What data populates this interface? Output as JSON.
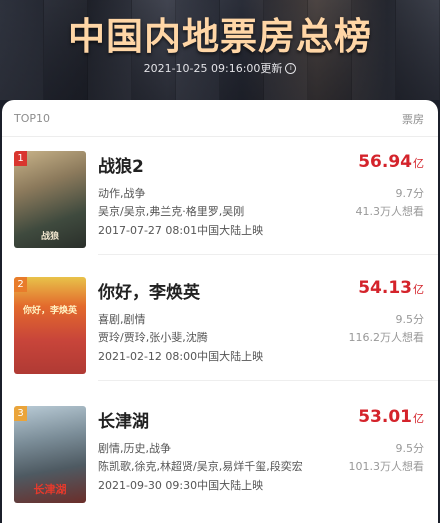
{
  "header": {
    "title": "中国内地票房总榜",
    "updated": "2021-10-25 09:16:00更新",
    "info_icon": "info-icon"
  },
  "list": {
    "label_left": "TOP10",
    "label_right": "票房",
    "items": [
      {
        "rank": "1",
        "title": "战狼2",
        "gross": "56.94",
        "gross_unit": "亿",
        "genre": "动作,战争",
        "cast": "吴京/吴京,弗兰克·格里罗,吴刚",
        "release": "2017-07-27 08:01中国大陆上映",
        "score": "9.7分",
        "wants": "41.3万人想看",
        "poster_caption": "战狼",
        "rank_color": "#d9362f"
      },
      {
        "rank": "2",
        "title": "你好，李焕英",
        "gross": "54.13",
        "gross_unit": "亿",
        "genre": "喜剧,剧情",
        "cast": "贾玲/贾玲,张小斐,沈腾",
        "release": "2021-02-12 08:00中国大陆上映",
        "score": "9.5分",
        "wants": "116.2万人想看",
        "poster_caption": "你好，李焕英",
        "rank_color": "#e87c2b"
      },
      {
        "rank": "3",
        "title": "长津湖",
        "gross": "53.01",
        "gross_unit": "亿",
        "genre": "剧情,历史,战争",
        "cast": "陈凯歌,徐克,林超贤/吴京,易烊千玺,段奕宏",
        "release": "2021-09-30 09:30中国大陆上映",
        "score": "9.5分",
        "wants": "101.3万人想看",
        "poster_caption": "长津湖",
        "rank_color": "#eaa43a"
      }
    ]
  }
}
